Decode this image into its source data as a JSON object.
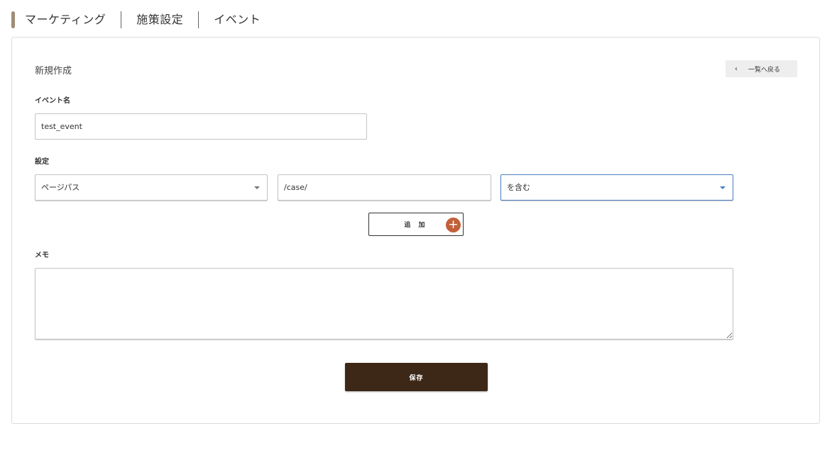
{
  "breadcrumb": {
    "items": [
      "マーケティング",
      "施策設定",
      "イベント"
    ],
    "accent_color": "#a08c76"
  },
  "card": {
    "title": "新規作成",
    "back_button": {
      "icon": "chevron-left-icon",
      "label": "一覧へ戻る"
    }
  },
  "event_name": {
    "label": "イベント名",
    "value": "test_event"
  },
  "settings": {
    "label": "設定",
    "type_select": {
      "value": "ページパス"
    },
    "path_input": {
      "value": "/case/"
    },
    "match_select": {
      "value": "を含む",
      "focus_color": "#4a7fc1"
    }
  },
  "add_button": {
    "label": "追 加",
    "icon": "plus-circle-icon",
    "icon_color": "#c2603a"
  },
  "memo": {
    "label": "メモ",
    "value": ""
  },
  "save_button": {
    "label": "保存",
    "color": "#3d2817"
  }
}
